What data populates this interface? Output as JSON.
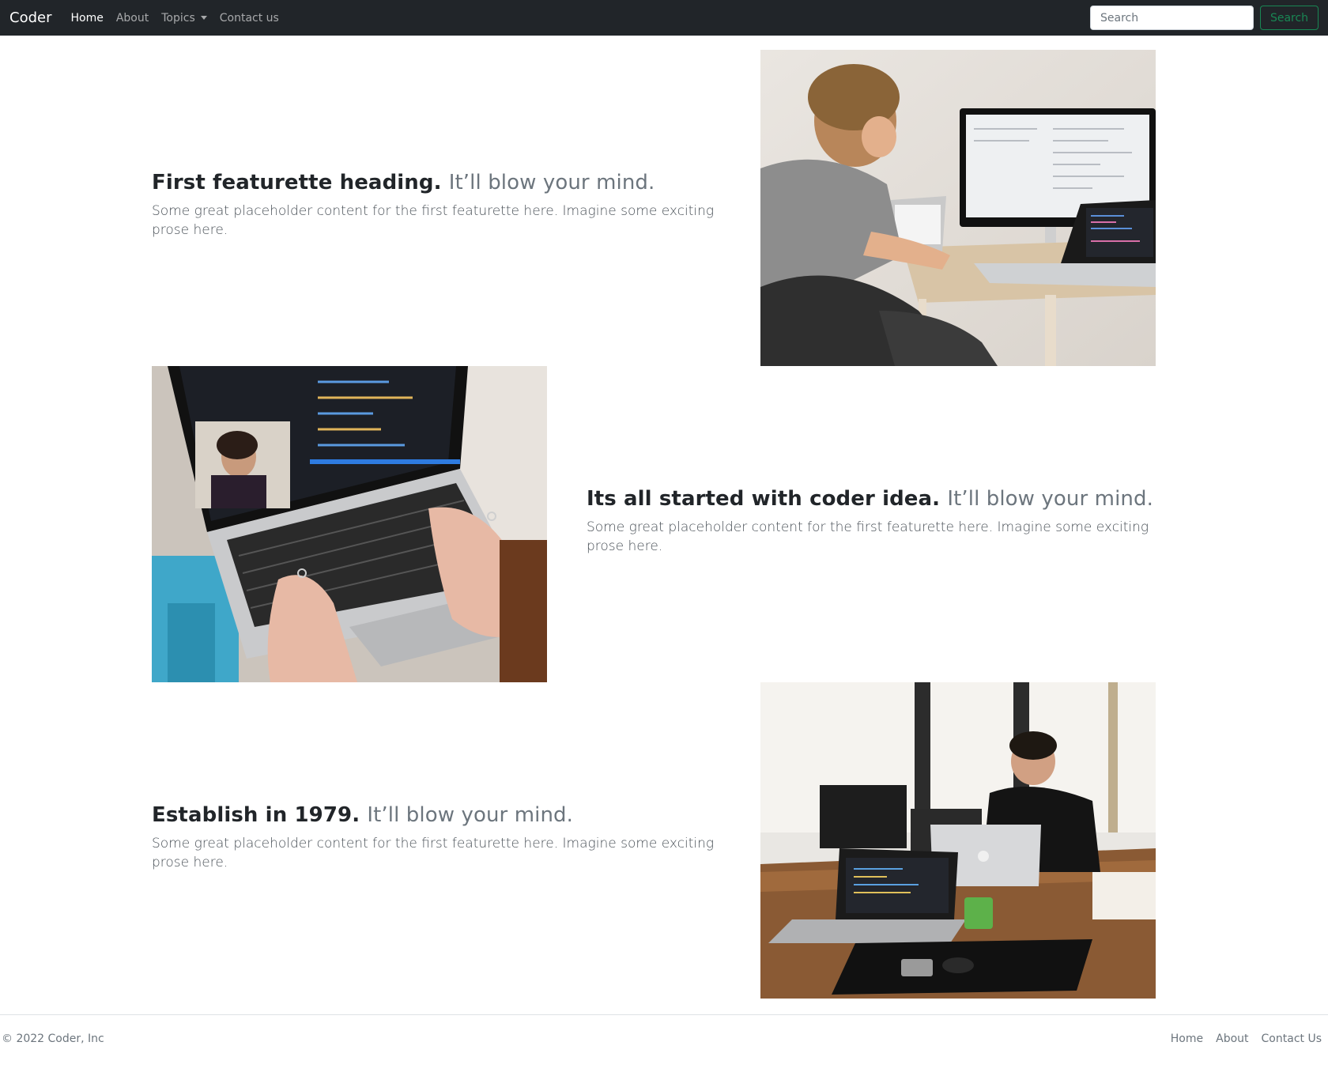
{
  "navbar": {
    "brand": "Coder",
    "links": [
      {
        "label": "Home",
        "active": true
      },
      {
        "label": "About"
      },
      {
        "label": "Topics"
      },
      {
        "label": "Contact us"
      }
    ],
    "search": {
      "placeholder": "Search",
      "button_label": "Search"
    }
  },
  "featurettes": [
    {
      "heading": "First featurette heading.",
      "muted": "It’ll blow your mind.",
      "lead": "Some great placeholder content for the first featurette here. Imagine some exciting prose here.",
      "image": "man-at-desk-with-monitor-photo"
    },
    {
      "heading": "Its all started with coder idea.",
      "muted": "It’ll blow your mind.",
      "lead": "Some great placeholder content for the first featurette here. Imagine some exciting prose here.",
      "image": "hands-typing-on-laptop-photo"
    },
    {
      "heading": "Establish in 1979.",
      "muted": "It’ll blow your mind.",
      "lead": "Some great placeholder content for the first featurette here. Imagine some exciting prose here.",
      "image": "office-workspace-laptops-photo"
    }
  ],
  "footer": {
    "copyright": "© 2022 Coder, Inc",
    "links": [
      "Home",
      "About",
      "Contact Us"
    ]
  }
}
